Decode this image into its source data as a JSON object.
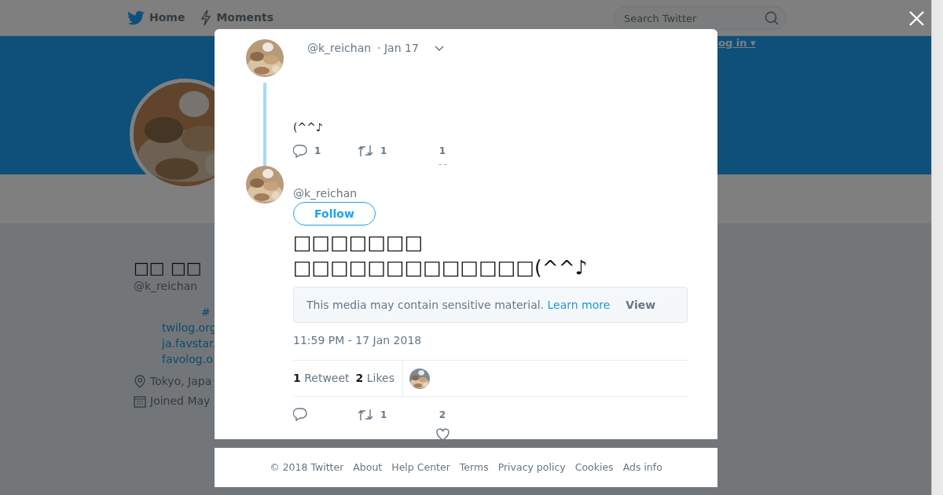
{
  "nav": {
    "items": [
      {
        "label": "Home",
        "kind": "bird"
      },
      {
        "label": "Moments",
        "kind": "bolt"
      }
    ],
    "search": {
      "placeholder": "Search Twitter"
    },
    "login": "og in ▾"
  },
  "profile": {
    "name": "□□ □□",
    "handle": "@k_reichan",
    "hashtag": "#",
    "links": [
      "twilog.org",
      "ja.favstar.",
      "favolog.o"
    ],
    "location": "Tokyo, Japa",
    "joined": "Joined May"
  },
  "modal": {
    "parent_tweet": {
      "handle": "@k_reichan",
      "time": "· Jan 17",
      "text": "(^^♪",
      "replies": "1",
      "retweets": "1",
      "likes": "1"
    },
    "tweet": {
      "handle": "@k_reichan",
      "follow": "Follow",
      "text_lines": [
        "□□□□□□□",
        "□□□□□□□□□□□□□(^^♪"
      ],
      "sensitive": {
        "text": "This media may contain sensitive material.",
        "link": "Learn more",
        "button": "View"
      },
      "timestamp": "11:59 PM - 17 Jan 2018",
      "stats": [
        {
          "count": "1",
          "label": "Retweet"
        },
        {
          "count": "2",
          "label": "Likes"
        }
      ],
      "retweets": "1",
      "likes": "2"
    }
  },
  "footer": [
    "© 2018 Twitter",
    "About",
    "Help Center",
    "Terms",
    "Privacy policy",
    "Cookies",
    "Ads info"
  ]
}
